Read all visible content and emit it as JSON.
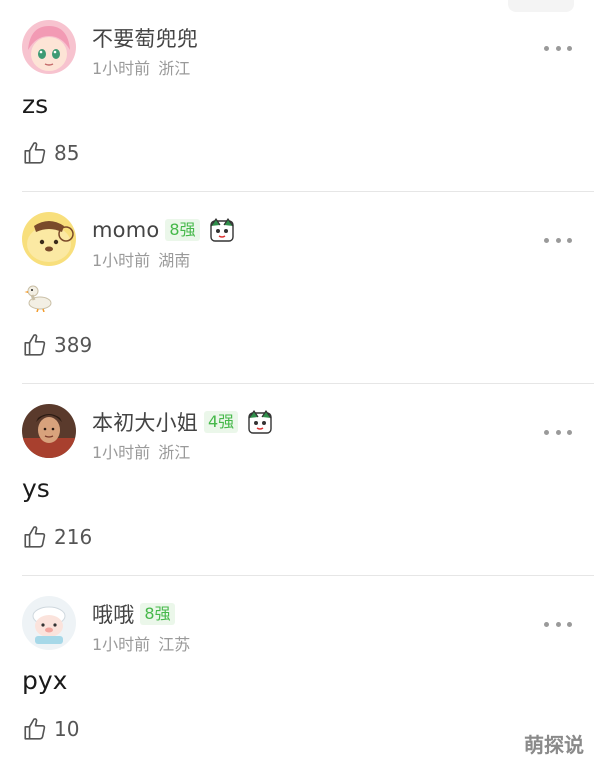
{
  "comments": [
    {
      "username": "不要萄兜兜",
      "level": "",
      "time": "1小时前",
      "location": "浙江",
      "text": "zs",
      "likes": "85",
      "has_fan_icon": false,
      "avatar": "anime-girl-avatar"
    },
    {
      "username": "momo",
      "level": "8强",
      "time": "1小时前",
      "location": "湖南",
      "text": "",
      "body_icon": "duck-emoji",
      "likes": "389",
      "has_fan_icon": true,
      "avatar": "pompompurin-avatar"
    },
    {
      "username": "本初大小姐",
      "level": "4强",
      "time": "1小时前",
      "location": "浙江",
      "text": "ys",
      "likes": "216",
      "has_fan_icon": true,
      "avatar": "portrait-avatar"
    },
    {
      "username": "哦哦",
      "level": "8强",
      "time": "1小时前",
      "location": "江苏",
      "text": "pyx",
      "likes": "10",
      "has_fan_icon": false,
      "avatar": "cartoon-sheep-avatar"
    }
  ],
  "watermark": "萌探说",
  "colors": {
    "level_text": "#46b84a",
    "level_bg": "#ebf7ea",
    "meta": "#9a9a9a",
    "divider": "#e6e6e6"
  },
  "icons": {
    "like": "thumbs-up-icon",
    "more": "more-dots-icon",
    "fan": "fan-badge-icon"
  }
}
